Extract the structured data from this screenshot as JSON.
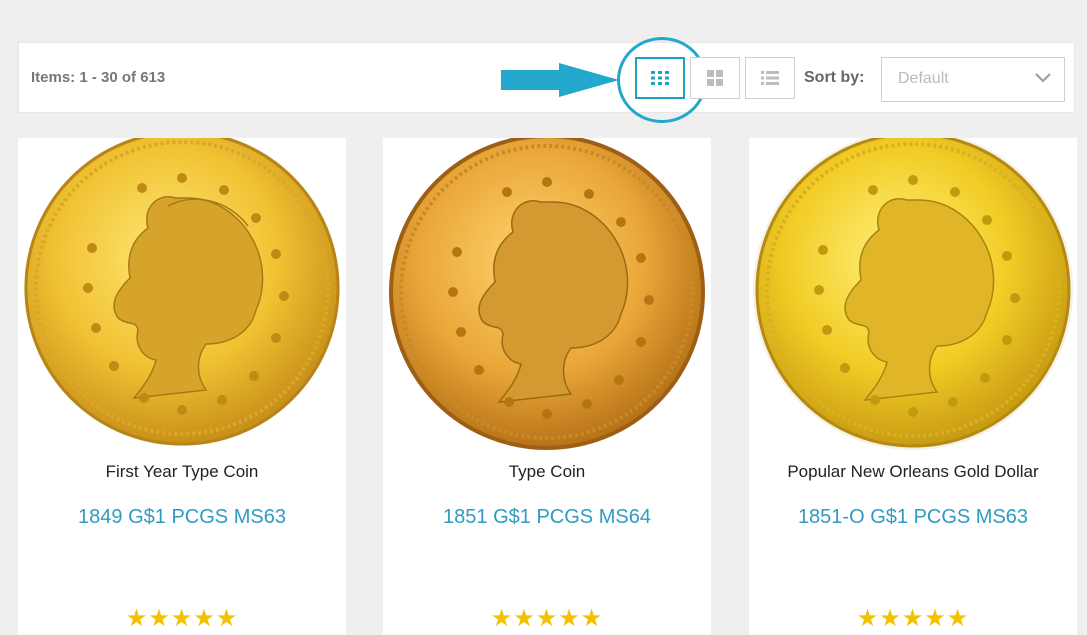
{
  "toolbar": {
    "items_text": "Items: 1 - 30 of 613",
    "sort_label": "Sort by:",
    "sort_value": "Default"
  },
  "colors": {
    "accent": "#1ea3c6",
    "price_link": "#2f9bc4",
    "star": "#f2c200",
    "gold": "#e6b521"
  },
  "products": [
    {
      "title": "First Year Type Coin",
      "name": "1849 G$1 PCGS MS63",
      "rating_stars": "★★★★★",
      "rating": 5
    },
    {
      "title": "Type Coin",
      "name": "1851 G$1 PCGS MS64",
      "rating_stars": "★★★★★",
      "rating": 5
    },
    {
      "title": "Popular New Orleans Gold Dollar",
      "name": "1851-O G$1 PCGS MS63",
      "rating_stars": "★★★★★",
      "rating": 5
    }
  ]
}
